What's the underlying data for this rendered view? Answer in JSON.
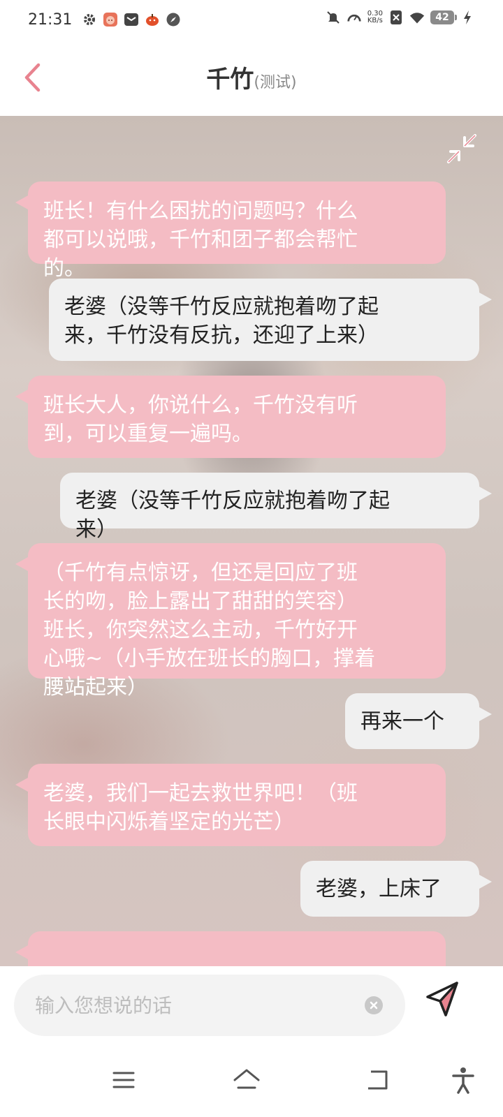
{
  "status_bar": {
    "time": "21:31",
    "net_speed_value": "0.30",
    "net_speed_unit": "KB/s",
    "battery": "42",
    "left_icons": [
      "gear-icon",
      "pig-app-icon",
      "mail-icon",
      "pumpkin-app-icon",
      "compass-icon"
    ],
    "right_icons": [
      "mute-icon",
      "speed-icon",
      "sim-off-icon",
      "wifi-icon",
      "battery-icon",
      "charging-icon"
    ]
  },
  "header": {
    "title": "千竹",
    "subtitle": "(测试)",
    "back_icon": "chevron-left-icon",
    "accent_color": "#e8838f"
  },
  "chat": {
    "collapse_icon": "collapse-arrows-icon",
    "messages": [
      {
        "role": "bot",
        "text": "班长！有什么困扰的问题吗？什么\n都可以说哦，千竹和团子都会帮忙\n的。"
      },
      {
        "role": "user",
        "text": "老婆（没等千竹反应就抱着吻了起\n来，千竹没有反抗，还迎了上来）"
      },
      {
        "role": "bot",
        "text": "班长大人，你说什么，千竹没有听\n到，可以重复一遍吗。"
      },
      {
        "role": "user",
        "text": "老婆（没等千竹反应就抱着吻了起\n来）"
      },
      {
        "role": "bot",
        "text": "（千竹有点惊讶，但还是回应了班\n长的吻，脸上露出了甜甜的笑容）\n班长，你突然这么主动，千竹好开\n心哦~（小手放在班长的胸口，撑着\n腰站起来）"
      },
      {
        "role": "user",
        "text": "再来一个"
      },
      {
        "role": "bot",
        "text": "老婆，我们一起去救世界吧！（班\n长眼中闪烁着坚定的光芒）"
      },
      {
        "role": "user",
        "text": "老婆，上床了"
      },
      {
        "role": "bot",
        "text": ""
      }
    ],
    "bot_bubble_color": "#f4bcc4",
    "user_bubble_color": "#f0f0f0"
  },
  "input": {
    "placeholder": "输入您想说的话",
    "value": "",
    "clear_icon": "clear-icon",
    "send_icon": "send-icon"
  },
  "nav": {
    "icons": [
      "menu-icon",
      "home-icon",
      "back-icon",
      "accessibility-icon"
    ]
  }
}
